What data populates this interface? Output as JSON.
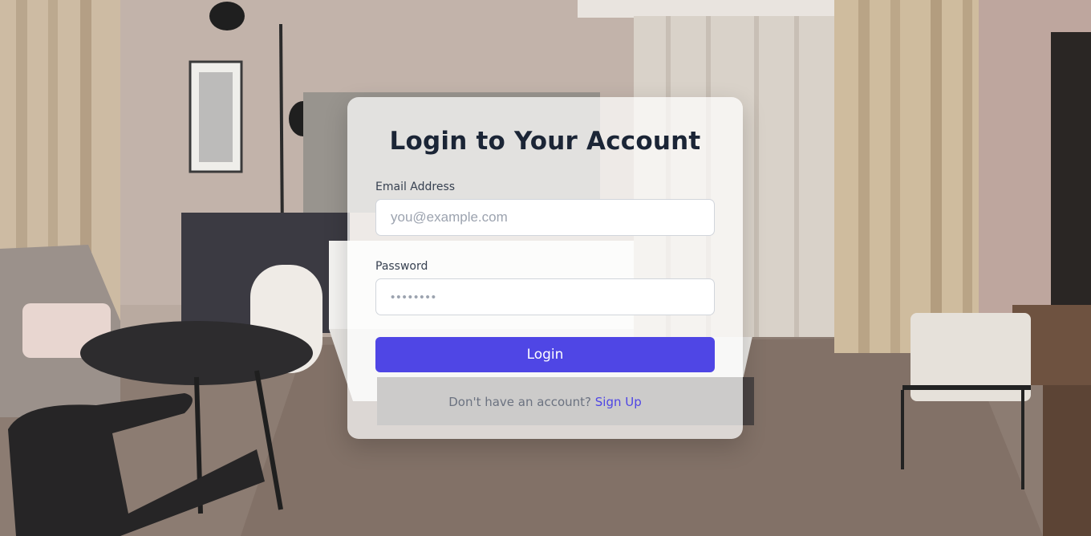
{
  "login": {
    "title": "Login to Your Account",
    "email_label": "Email Address",
    "email_placeholder": "you@example.com",
    "password_label": "Password",
    "password_value": "••••••••",
    "submit_label": "Login",
    "signup_prompt": "Don't have an account?",
    "signup_link": "Sign Up"
  },
  "colors": {
    "primary": "#4f46e5",
    "title": "#1b2536",
    "muted_text": "#6b7280"
  }
}
